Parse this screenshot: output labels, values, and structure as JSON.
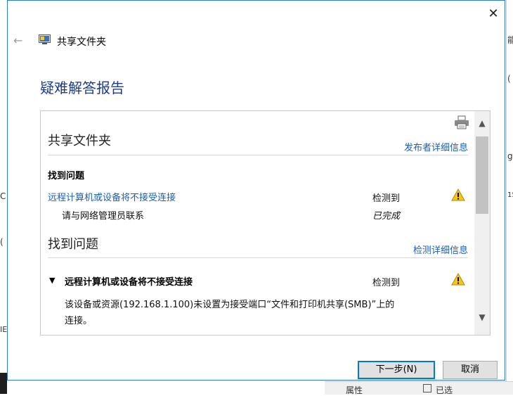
{
  "background": {
    "left_fragments": [
      "C",
      "(",
      "IE"
    ],
    "right_fragments": [
      "能",
      "(",
      "g",
      "15"
    ],
    "bottom_fragments": [
      "属性",
      "已选"
    ]
  },
  "window": {
    "title": "共享文件夹",
    "close_label": "✕",
    "back_label": "←"
  },
  "page": {
    "title": "疑难解答报告"
  },
  "report": {
    "section1": {
      "title": "共享文件夹",
      "link": "发布者详细信息",
      "found_label": "找到问题",
      "issue": {
        "link": "远程计算机或设备将不接受连接",
        "status": "检测到",
        "sub": "请与网络管理员联系",
        "sub_status": "已完成"
      }
    },
    "section2": {
      "title": "找到问题",
      "link": "检测详细信息",
      "issue": {
        "expander": "▼",
        "title": "远程计算机或设备将不接受连接",
        "status": "检测到",
        "description_line1": "该设备或资源(192.168.1.100)未设置为接受端口“文件和打印机共享(SMB)”上的",
        "description_line2": "连接。"
      }
    },
    "scroll_up": "▲",
    "scroll_down": "▼"
  },
  "buttons": {
    "next": "下一步(N)",
    "cancel": "取消"
  },
  "colors": {
    "accent": "#1a3d8f",
    "link": "#1a5fb4",
    "warning": "#f5c518",
    "dialog_border": "#2b7bd6"
  },
  "icons": {
    "printer": "printer-icon",
    "warning": "warning-icon",
    "app": "shared-folder-icon"
  }
}
